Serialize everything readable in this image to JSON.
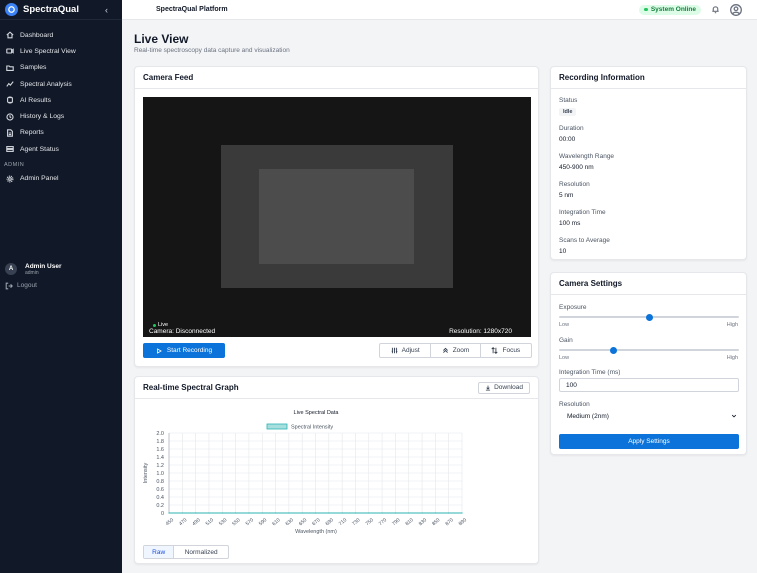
{
  "app": {
    "name": "SpectraQual",
    "collapse_glyph": "‹"
  },
  "sidebar": {
    "items": [
      {
        "label": "Dashboard",
        "icon": "home-icon"
      },
      {
        "label": "Live Spectral View",
        "icon": "video-icon"
      },
      {
        "label": "Samples",
        "icon": "folder-icon"
      },
      {
        "label": "Spectral Analysis",
        "icon": "chart-line-icon"
      },
      {
        "label": "AI Results",
        "icon": "brain-icon"
      },
      {
        "label": "History & Logs",
        "icon": "history-icon"
      },
      {
        "label": "Reports",
        "icon": "file-icon"
      },
      {
        "label": "Agent Status",
        "icon": "server-icon"
      }
    ],
    "admin_section": "ADMIN",
    "admin_item": {
      "label": "Admin Panel",
      "icon": "gear-icon"
    },
    "user": {
      "initial": "A",
      "name": "Admin User",
      "role": "admin"
    },
    "logout": "Logout"
  },
  "topbar": {
    "title": "SpectraQual Platform",
    "status": "System Online",
    "status_color": "#22c55e"
  },
  "page": {
    "title": "Live View",
    "subtitle": "Real-time spectroscopy data capture and visualization"
  },
  "camera": {
    "title": "Camera Feed",
    "live": "Live",
    "status": "Camera: Disconnected",
    "resolution": "Resolution: 1280x720",
    "start_recording": "Start Recording",
    "adjust": "Adjust",
    "zoom": "Zoom",
    "focus": "Focus"
  },
  "recording": {
    "title": "Recording Information",
    "status_label": "Status",
    "status_value": "Idle",
    "duration_label": "Duration",
    "duration_value": "00:00",
    "wavelength_label": "Wavelength Range",
    "wavelength_value": "450-900 nm",
    "resolution_label": "Resolution",
    "resolution_value": "5 nm",
    "integration_label": "Integration Time",
    "integration_value": "100 ms",
    "scans_label": "Scans to Average",
    "scans_value": "10"
  },
  "settings": {
    "title": "Camera Settings",
    "exposure_label": "Exposure",
    "exposure_level": 0.5,
    "gain_label": "Gain",
    "gain_level": 0.3,
    "low": "Low",
    "high": "High",
    "integration_label": "Integration Time (ms)",
    "integration_value": "100",
    "resolution_label": "Resolution",
    "resolution_value": "Medium (2nm)",
    "apply": "Apply Settings"
  },
  "graph": {
    "title": "Real-time Spectral Graph",
    "download": "Download",
    "raw": "Raw",
    "normalized": "Normalized"
  },
  "chart_data": {
    "type": "line",
    "title": "Live Spectral Data",
    "xlabel": "Wavelength (nm)",
    "ylabel": "Intensity",
    "x": [
      450,
      470,
      490,
      510,
      530,
      550,
      570,
      590,
      610,
      630,
      650,
      670,
      690,
      710,
      730,
      750,
      770,
      790,
      810,
      830,
      850,
      870,
      890
    ],
    "series": [
      {
        "name": "Spectral Intensity",
        "color": "#2bb3b3",
        "values": [
          0,
          0,
          0,
          0,
          0,
          0,
          0,
          0,
          0,
          0,
          0,
          0,
          0,
          0,
          0,
          0,
          0,
          0,
          0,
          0,
          0,
          0,
          0
        ]
      }
    ],
    "yticks": [
      "0",
      "0.2",
      "0.4",
      "0.6",
      "0.8",
      "1.0",
      "1.2",
      "1.4",
      "1.6",
      "1.8",
      "2.0"
    ],
    "ylim": [
      0,
      2.0
    ],
    "grid": true,
    "legend": "top-center"
  }
}
